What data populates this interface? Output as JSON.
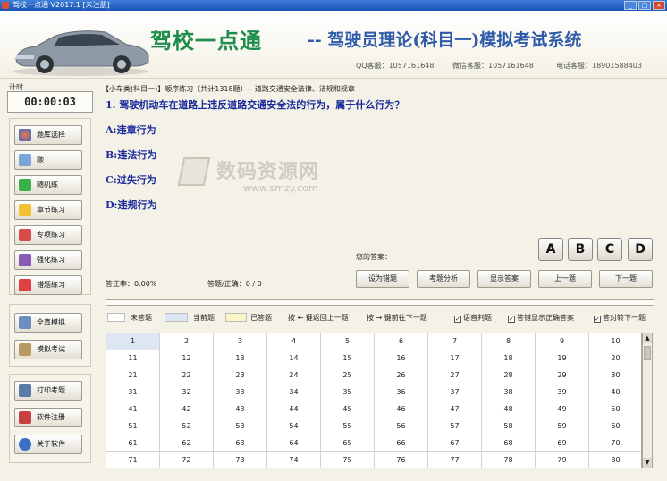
{
  "window": {
    "title": "驾校一点通 V2017.1 [未注册]"
  },
  "header": {
    "brand": "驾校一点通",
    "subtitle": "-- 驾驶员理论(科目一)模拟考试系统",
    "qq": "QQ客服：1057161648",
    "wechat": "微信客服：1057161648",
    "phone": "电话客服：18901588403"
  },
  "timer": {
    "label": "计时",
    "value": "00:00:03"
  },
  "nav": [
    {
      "label": "题库选择",
      "icon": "library-icon"
    },
    {
      "label": "顺",
      "icon": "sequence-icon"
    },
    {
      "label": "随机练",
      "icon": "shuffle-icon"
    },
    {
      "label": "章节练习",
      "icon": "folder-icon"
    },
    {
      "label": "专项练习",
      "icon": "checklist-icon"
    },
    {
      "label": "强化练习",
      "icon": "chart-icon"
    },
    {
      "label": "错题练习",
      "icon": "flag-icon"
    },
    {
      "label": "全真模拟",
      "icon": "document-icon"
    },
    {
      "label": "模拟考试",
      "icon": "exam-icon"
    },
    {
      "label": "打印考题",
      "icon": "printer-icon"
    },
    {
      "label": "软件注册",
      "icon": "key-icon"
    },
    {
      "label": "关于软件",
      "icon": "info-icon"
    }
  ],
  "breadcrumb": "【小车类(科目一)】顺序练习（共计1318题）--  道路交通安全法律、法规和规章",
  "question": "1. 驾驶机动车在道路上违反道路交通安全法的行为，属于什么行为？",
  "options": [
    "A:违章行为",
    "B:违法行为",
    "C:过失行为",
    "D:违规行为"
  ],
  "watermark": {
    "text": "数码资源网",
    "url": "www.smzy.com"
  },
  "answer_label": "您的答案：",
  "answer_buttons": [
    "A",
    "B",
    "C",
    "D"
  ],
  "stats": {
    "accuracy": "答正率：0.00%",
    "answered": "答题/正确：0 / 0"
  },
  "actions": [
    "设为错题",
    "考题分析",
    "显示答案",
    "上一题",
    "下一题"
  ],
  "legend": {
    "unanswered": "未答题",
    "current": "当前题",
    "answered": "已答题",
    "prev_hint": "按 ← 键返回上一题",
    "next_hint": "按 → 键前往下一题"
  },
  "checkboxes": [
    "语音判题",
    "答错显示正确答案",
    "答对转下一题"
  ],
  "colors": {
    "current": "#dfe6f3",
    "answered": "#fbf6c6",
    "unanswered": "#ffffff",
    "question": "#1a2a9c",
    "brand": "#1e8c4a"
  },
  "grid": {
    "columns": 10,
    "rows": 8,
    "current": 1,
    "numbers_from": 1,
    "numbers_to": 80
  }
}
